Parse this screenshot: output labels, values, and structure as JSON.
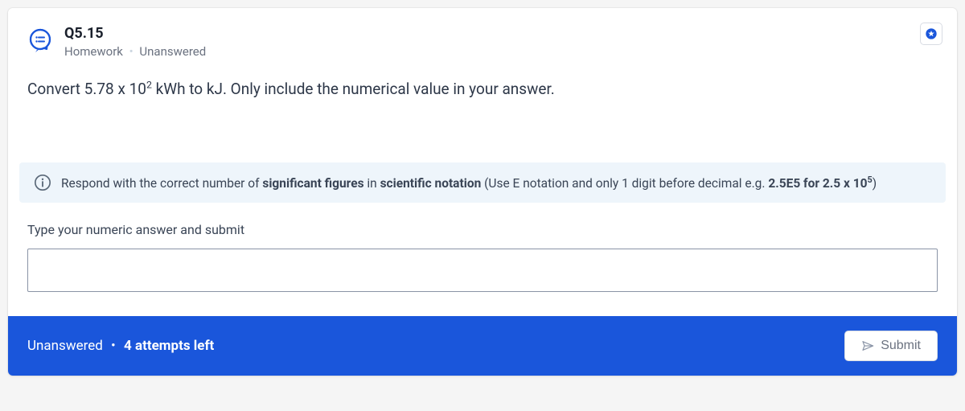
{
  "header": {
    "question_number": "Q5.15",
    "category": "Homework",
    "status": "Unanswered"
  },
  "prompt": {
    "prefix": "Convert 5.78 x 10",
    "exponent": "2",
    "suffix": " kWh to kJ. Only include the numerical value in your answer."
  },
  "info_banner": {
    "part1": "Respond with the correct number of ",
    "bold1": "significant figures",
    "part2": " in ",
    "bold2": "scientific notation",
    "part3": " (Use E notation and only 1 digit before decimal e.g. ",
    "bold3_prefix": "2.5E5 for 2.5 x 10",
    "bold3_exp": "5",
    "part4": ")"
  },
  "answer": {
    "label": "Type your numeric answer and submit",
    "value": ""
  },
  "footer": {
    "status": "Unanswered",
    "attempts_count": "4",
    "attempts_suffix": " attempts left",
    "submit_label": "Submit"
  }
}
